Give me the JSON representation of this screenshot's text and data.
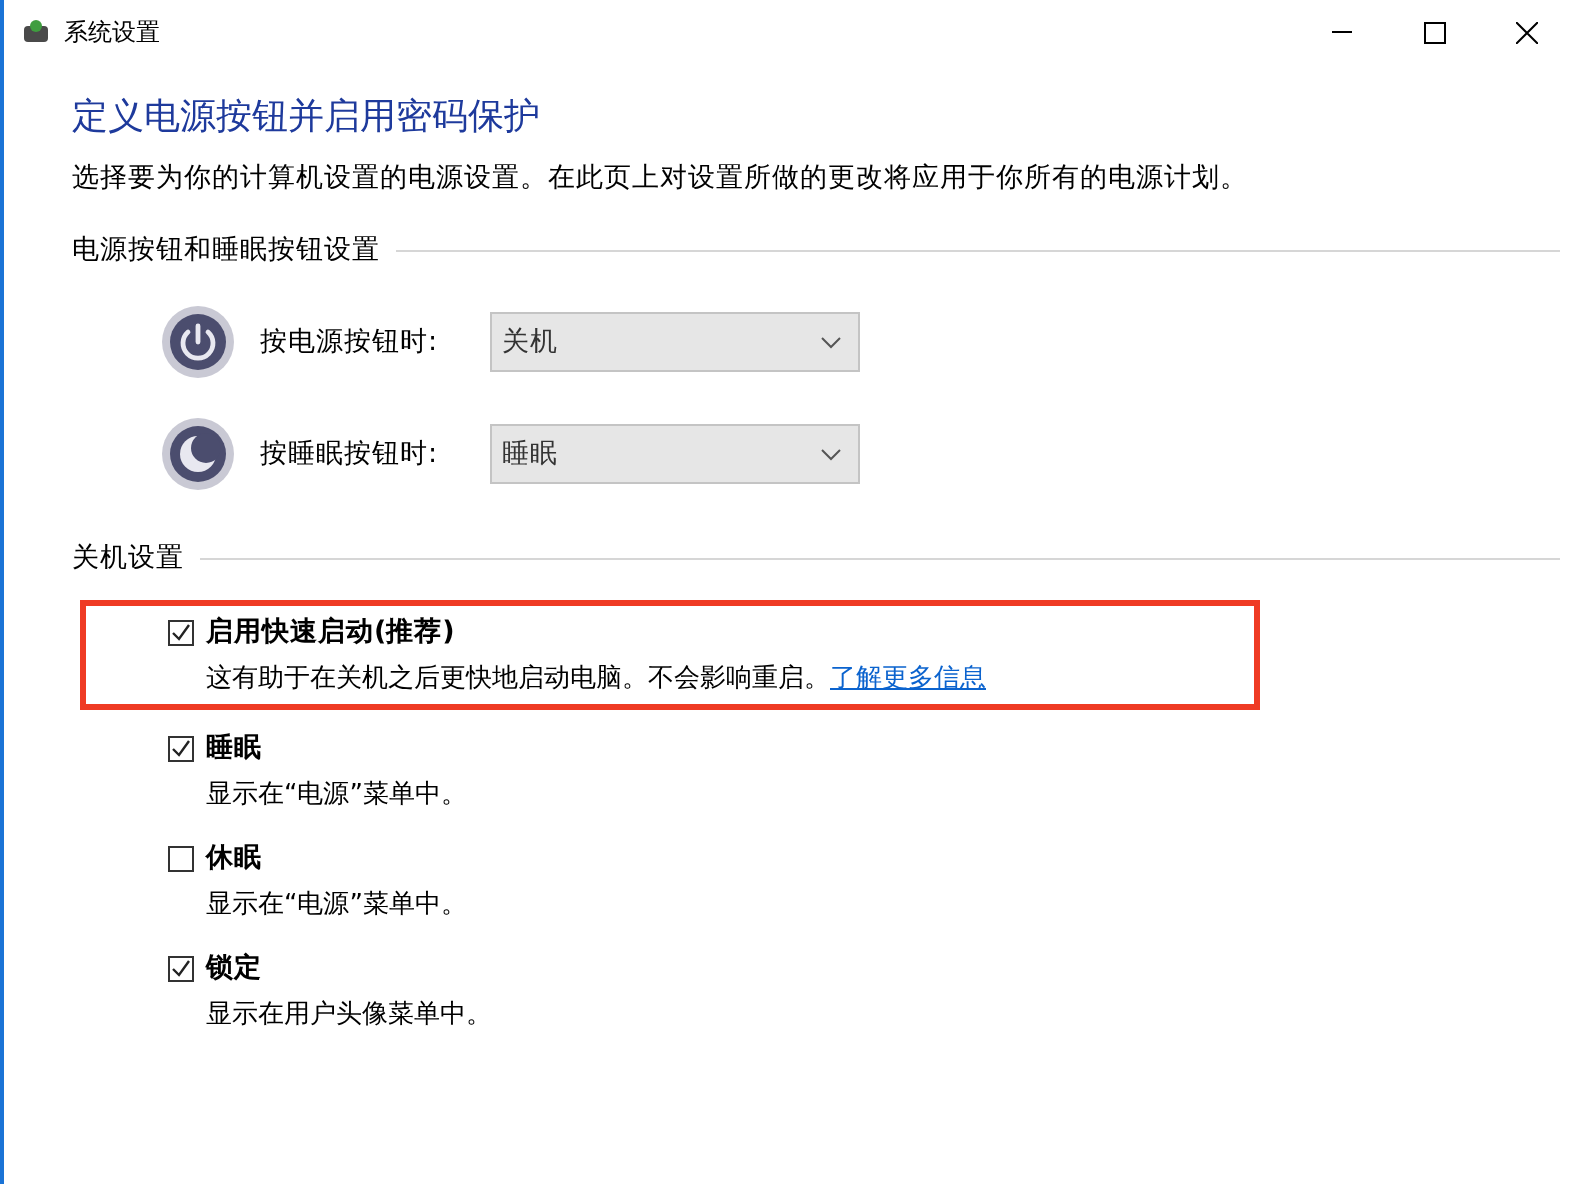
{
  "window": {
    "title": "系统设置"
  },
  "heading": "定义电源按钮并启用密码保护",
  "description": "选择要为你的计算机设置的电源设置。在此页上对设置所做的更改将应用于你所有的电源计划。",
  "button_section": {
    "title": "电源按钮和睡眠按钮设置",
    "rows": [
      {
        "kind": "power",
        "label": "按电源按钮时:",
        "value": "关机",
        "disabled": true
      },
      {
        "kind": "sleep",
        "label": "按睡眠按钮时:",
        "value": "睡眠",
        "disabled": true
      }
    ]
  },
  "shutdown_section": {
    "title": "关机设置",
    "options": [
      {
        "label": "启用快速启动(推荐)",
        "checked": true,
        "highlighted": true,
        "description": "这有助于在关机之后更快地启动电脑。不会影响重启。",
        "link": "了解更多信息"
      },
      {
        "label": "睡眠",
        "checked": true,
        "highlighted": false,
        "description": "显示在“电源”菜单中。"
      },
      {
        "label": "休眠",
        "checked": false,
        "highlighted": false,
        "description": "显示在“电源”菜单中。"
      },
      {
        "label": "锁定",
        "checked": true,
        "highlighted": false,
        "description": "显示在用户头像菜单中。"
      }
    ]
  }
}
